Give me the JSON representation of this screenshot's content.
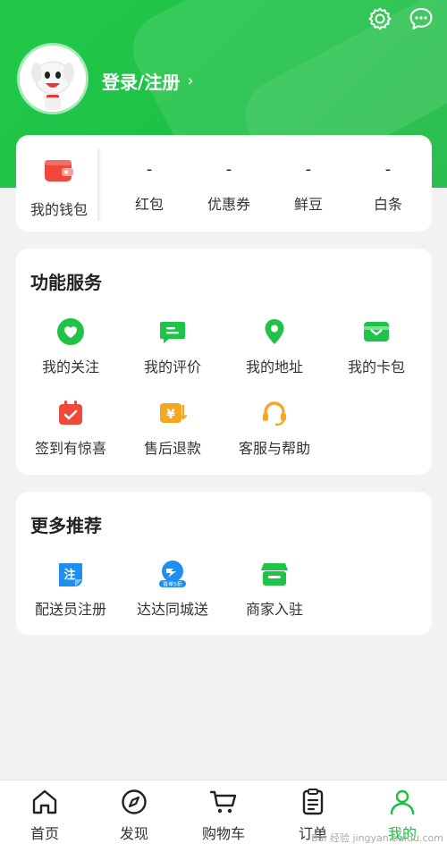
{
  "header": {
    "login_text": "登录/注册",
    "login_chevron": "›"
  },
  "wallet": {
    "main_label": "我的钱包",
    "items": [
      {
        "value": "-",
        "label": "红包"
      },
      {
        "value": "-",
        "label": "优惠券"
      },
      {
        "value": "-",
        "label": "鲜豆"
      },
      {
        "value": "-",
        "label": "白条"
      }
    ]
  },
  "services": {
    "title": "功能服务",
    "items": [
      {
        "label": "我的关注",
        "icon": "heart-icon"
      },
      {
        "label": "我的评价",
        "icon": "comment-icon"
      },
      {
        "label": "我的地址",
        "icon": "location-pin-icon"
      },
      {
        "label": "我的卡包",
        "icon": "card-wallet-icon"
      },
      {
        "label": "签到有惊喜",
        "icon": "calendar-check-icon"
      },
      {
        "label": "售后退款",
        "icon": "refund-icon"
      },
      {
        "label": "客服与帮助",
        "icon": "headset-icon"
      }
    ]
  },
  "more": {
    "title": "更多推荐",
    "items": [
      {
        "label": "配送员注册",
        "icon": "courier-register-icon",
        "glyph": "注"
      },
      {
        "label": "达达同城送",
        "icon": "dada-delivery-icon",
        "badge": "首单5折"
      },
      {
        "label": "商家入驻",
        "icon": "store-icon"
      }
    ]
  },
  "tabbar": {
    "items": [
      {
        "label": "首页",
        "icon": "home-icon"
      },
      {
        "label": "发现",
        "icon": "compass-icon"
      },
      {
        "label": "购物车",
        "icon": "cart-icon"
      },
      {
        "label": "订单",
        "icon": "order-list-icon"
      },
      {
        "label": "我的",
        "icon": "profile-icon",
        "active": true
      }
    ]
  },
  "colors": {
    "brand_green": "#1fc347",
    "accent_red": "#f0483c",
    "accent_orange": "#f5a623"
  },
  "watermark": "Bai 经验 jingyan.baidu.com"
}
